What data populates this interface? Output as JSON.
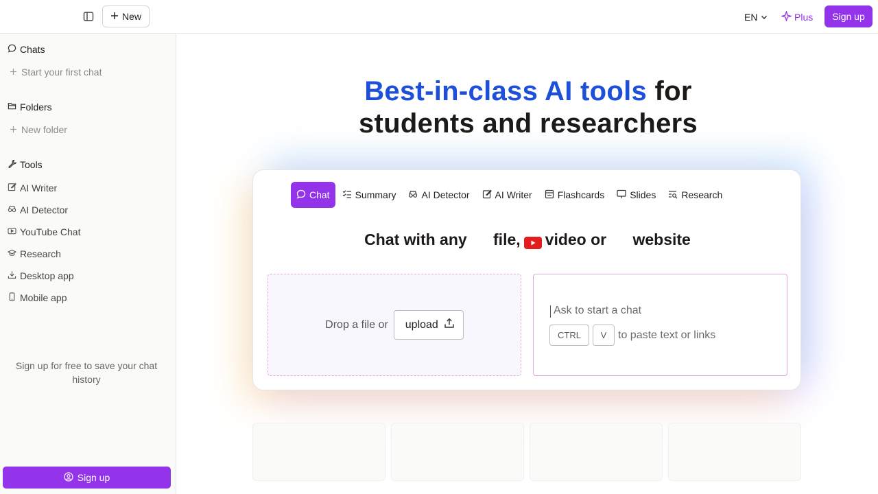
{
  "topbar": {
    "new_label": "New",
    "language": "EN",
    "plus_label": "Plus",
    "signup_label": "Sign up"
  },
  "sidebar": {
    "chats_heading": "Chats",
    "start_chat": "Start your first chat",
    "folders_heading": "Folders",
    "new_folder": "New folder",
    "tools_heading": "Tools",
    "tools": [
      {
        "label": "AI Writer",
        "icon": "pencil-icon"
      },
      {
        "label": "AI Detector",
        "icon": "glasses-icon"
      },
      {
        "label": "YouTube Chat",
        "icon": "video-icon"
      },
      {
        "label": "Research",
        "icon": "graduation-cap-icon"
      },
      {
        "label": "Desktop app",
        "icon": "download-icon"
      },
      {
        "label": "Mobile app",
        "icon": "phone-icon"
      }
    ],
    "note": "Sign up for free to save your chat history",
    "signup_label": "Sign up"
  },
  "hero": {
    "accent": "Best-in-class AI tools",
    "rest_line1": "for",
    "line2": "students and researchers"
  },
  "card": {
    "tabs": [
      {
        "label": "Chat",
        "active": true
      },
      {
        "label": "Summary",
        "active": false
      },
      {
        "label": "AI Detector",
        "active": false
      },
      {
        "label": "AI Writer",
        "active": false
      },
      {
        "label": "Flashcards",
        "active": false
      },
      {
        "label": "Slides",
        "active": false
      },
      {
        "label": "Research",
        "active": false
      }
    ],
    "title_part1": "Chat with any      file,",
    "title_part2": "video or      website",
    "drop_text": "Drop a file or",
    "upload_label": "upload",
    "chat_placeholder": "Ask to start a chat",
    "kbd_ctrl": "CTRL",
    "kbd_v": "V",
    "paste_text": "to paste text or links"
  },
  "colors": {
    "accent_purple": "#9333ea",
    "hero_blue": "#1d4fd8",
    "youtube_red": "#e11d1d"
  }
}
